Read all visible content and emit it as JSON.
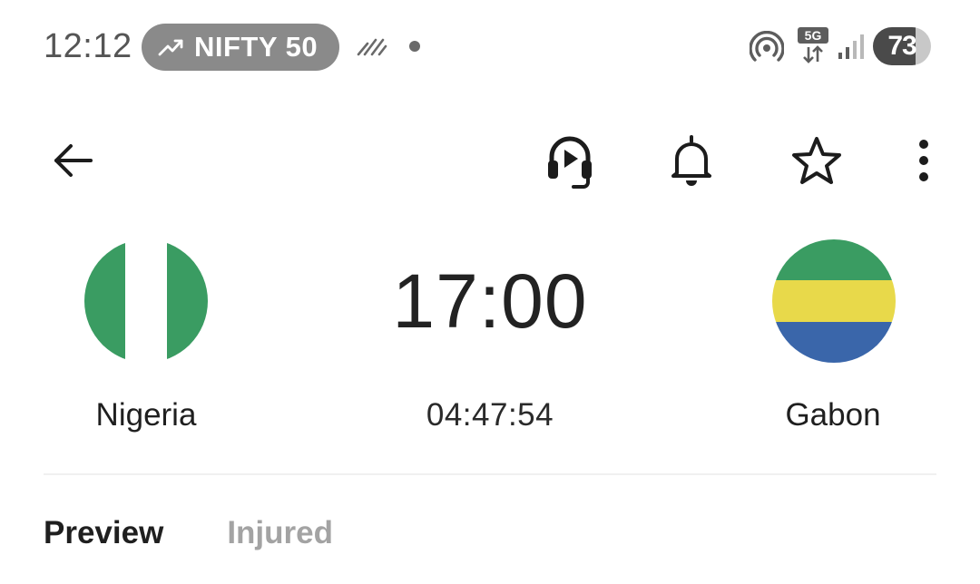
{
  "status_bar": {
    "time": "12:12",
    "ticker": "NIFTY 50",
    "network": "5G",
    "battery": "73",
    "battery_level_percent": 73
  },
  "app_bar": {
    "back_icon": "arrow-left-icon",
    "actions": [
      "headset-icon",
      "bell-icon",
      "star-icon",
      "more-vertical-icon"
    ]
  },
  "match": {
    "home_team": {
      "name": "Nigeria",
      "flag_colors": [
        "#3a9c62",
        "#ffffff",
        "#3a9c62"
      ]
    },
    "away_team": {
      "name": "Gabon",
      "flag_colors": [
        "#3a9c62",
        "#e8d94a",
        "#3a66aa"
      ]
    },
    "kickoff_time": "17:00",
    "countdown": "04:47:54"
  },
  "tabs": [
    {
      "label": "Preview",
      "active": true
    },
    {
      "label": "Injured",
      "active": false
    }
  ]
}
